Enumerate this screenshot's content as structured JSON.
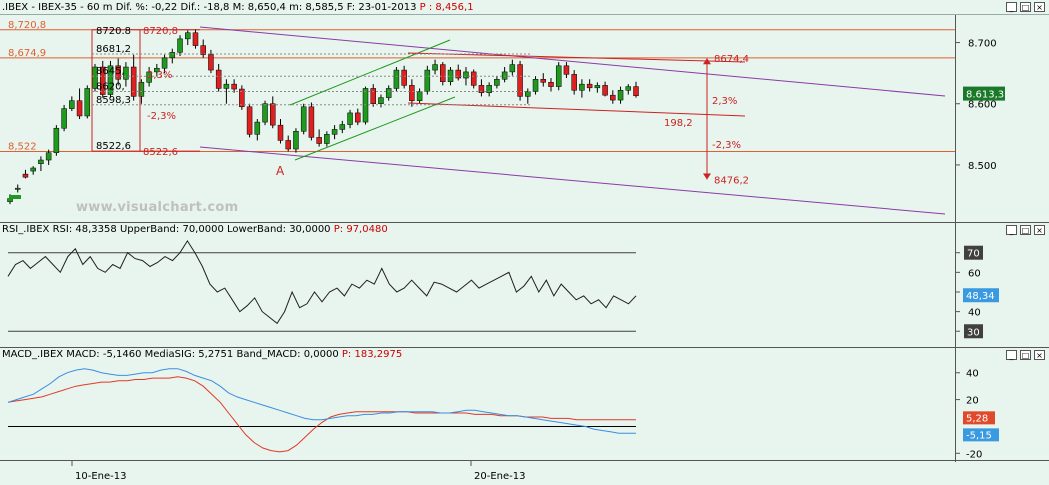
{
  "colors": {
    "background": "#e8f4ee",
    "axis_line": "#555555",
    "grid_dotted": "#8a8a8a",
    "support_resistance": "#e06030",
    "channel_purple": "#8a3aa8",
    "channel_green": "#1e9a1e",
    "range_red": "#cc2222",
    "candle_up": "#1f9a1f",
    "candle_down": "#dd2020",
    "rsi_line": "#202020",
    "macd_line": "#3a8ee0",
    "signal_line": "#e03a28",
    "last_price_box": "#1a7a2a",
    "rsi_box": "#3a9ae0",
    "macd_box": "#3a9ae0",
    "signal_box": "#e04a2a",
    "level_box": "#404040"
  },
  "headers": {
    "price": {
      "symbol": ".IBEX - IBEX-35 - 60 m",
      "dif_pct_label": "Dif. %:",
      "dif_pct": "-0,22",
      "dif_label": "Dif.:",
      "dif": "-18,8",
      "max_label": "M:",
      "max": "8,650,4",
      "min_label": "m:",
      "min": "8,585,5",
      "date_label": "F:",
      "date": "23-01-2013",
      "p_label": "P :",
      "p": "8,456,1"
    },
    "rsi": {
      "name": "RSI_.IBEX RSI:",
      "value": "48,3358",
      "upper_label": "UpperBand:",
      "upper": "70,0000",
      "lower_label": "LowerBand:",
      "lower": "30,0000",
      "p_label": "P:",
      "p": "97,0480"
    },
    "macd": {
      "name": "MACD_.IBEX MACD:",
      "value": "-5,1460",
      "signal_label": "MediaSIG:",
      "signal": "5,2751",
      "band_label": "Band_MACD:",
      "band": "0,0000",
      "p_label": "P:",
      "p": "183,2975"
    }
  },
  "window_buttons": [
    "_",
    "□",
    "×"
  ],
  "watermark": "www.visualchart.com",
  "chart_data": [
    {
      "type": "candlestick",
      "title": ".IBEX - IBEX-35 - 60 m",
      "x_ticks": [
        "10-Ene-13",
        "20-Ene-13"
      ],
      "y_ticks": [
        "8.700",
        "8.600",
        "8.500"
      ],
      "last_price": "8.613,3",
      "ylim": [
        8410,
        8745
      ],
      "bars": [
        [
          8440,
          8452,
          8436,
          8445
        ],
        [
          8460,
          8468,
          8455,
          8462
        ],
        [
          8485,
          8492,
          8478,
          8480
        ],
        [
          8490,
          8498,
          8484,
          8495
        ],
        [
          8502,
          8514,
          8490,
          8508
        ],
        [
          8508,
          8525,
          8500,
          8520
        ],
        [
          8520,
          8565,
          8515,
          8560
        ],
        [
          8560,
          8598,
          8555,
          8592
        ],
        [
          8592,
          8612,
          8588,
          8605
        ],
        [
          8605,
          8625,
          8575,
          8580
        ],
        [
          8580,
          8630,
          8576,
          8625
        ],
        [
          8625,
          8665,
          8620,
          8660
        ],
        [
          8660,
          8670,
          8610,
          8615
        ],
        [
          8615,
          8670,
          8610,
          8662
        ],
        [
          8662,
          8674,
          8630,
          8640
        ],
        [
          8640,
          8668,
          8628,
          8660
        ],
        [
          8660,
          8680,
          8605,
          8612
        ],
        [
          8612,
          8640,
          8600,
          8635
        ],
        [
          8635,
          8660,
          8628,
          8652
        ],
        [
          8652,
          8665,
          8645,
          8658
        ],
        [
          8658,
          8680,
          8650,
          8675
        ],
        [
          8675,
          8690,
          8666,
          8684
        ],
        [
          8684,
          8712,
          8678,
          8706
        ],
        [
          8706,
          8720,
          8696,
          8716
        ],
        [
          8716,
          8722,
          8690,
          8695
        ],
        [
          8695,
          8705,
          8675,
          8680
        ],
        [
          8680,
          8688,
          8650,
          8655
        ],
        [
          8655,
          8665,
          8620,
          8625
        ],
        [
          8625,
          8640,
          8600,
          8632
        ],
        [
          8632,
          8640,
          8618,
          8624
        ],
        [
          8624,
          8630,
          8590,
          8595
        ],
        [
          8595,
          8600,
          8545,
          8550
        ],
        [
          8550,
          8575,
          8540,
          8570
        ],
        [
          8570,
          8605,
          8565,
          8600
        ],
        [
          8600,
          8612,
          8560,
          8565
        ],
        [
          8565,
          8575,
          8535,
          8540
        ],
        [
          8540,
          8548,
          8522,
          8526
        ],
        [
          8526,
          8560,
          8520,
          8555
        ],
        [
          8555,
          8600,
          8550,
          8595
        ],
        [
          8595,
          8602,
          8540,
          8545
        ],
        [
          8545,
          8558,
          8530,
          8535
        ],
        [
          8535,
          8555,
          8530,
          8550
        ],
        [
          8550,
          8565,
          8542,
          8558
        ],
        [
          8558,
          8572,
          8552,
          8566
        ],
        [
          8566,
          8590,
          8560,
          8585
        ],
        [
          8585,
          8592,
          8565,
          8570
        ],
        [
          8570,
          8628,
          8566,
          8625
        ],
        [
          8625,
          8632,
          8595,
          8600
        ],
        [
          8600,
          8615,
          8594,
          8610
        ],
        [
          8610,
          8630,
          8605,
          8625
        ],
        [
          8625,
          8660,
          8620,
          8655
        ],
        [
          8655,
          8662,
          8625,
          8630
        ],
        [
          8630,
          8640,
          8595,
          8605
        ],
        [
          8605,
          8625,
          8600,
          8620
        ],
        [
          8620,
          8662,
          8615,
          8655
        ],
        [
          8655,
          8672,
          8648,
          8664
        ],
        [
          8664,
          8668,
          8630,
          8636
        ],
        [
          8636,
          8660,
          8630,
          8655
        ],
        [
          8655,
          8664,
          8638,
          8642
        ],
        [
          8642,
          8660,
          8630,
          8652
        ],
        [
          8652,
          8656,
          8625,
          8630
        ],
        [
          8630,
          8640,
          8612,
          8618
        ],
        [
          8618,
          8635,
          8612,
          8630
        ],
        [
          8630,
          8645,
          8625,
          8640
        ],
        [
          8640,
          8660,
          8635,
          8652
        ],
        [
          8652,
          8672,
          8646,
          8664
        ],
        [
          8664,
          8670,
          8605,
          8612
        ],
        [
          8612,
          8625,
          8600,
          8620
        ],
        [
          8620,
          8645,
          8615,
          8640
        ],
        [
          8640,
          8650,
          8628,
          8635
        ],
        [
          8635,
          8642,
          8620,
          8628
        ],
        [
          8628,
          8668,
          8622,
          8662
        ],
        [
          8662,
          8668,
          8642,
          8648
        ],
        [
          8648,
          8655,
          8615,
          8622
        ],
        [
          8622,
          8640,
          8610,
          8632
        ],
        [
          8632,
          8640,
          8620,
          8626
        ],
        [
          8626,
          8635,
          8618,
          8630
        ],
        [
          8630,
          8636,
          8612,
          8614
        ],
        [
          8614,
          8622,
          8600,
          8606
        ],
        [
          8606,
          8628,
          8600,
          8622
        ],
        [
          8622,
          8632,
          8615,
          8628
        ],
        [
          8628,
          8636,
          8610,
          8613
        ]
      ],
      "horizontal_levels": [
        {
          "value": 8720.8,
          "label": "8,720,8"
        },
        {
          "value": 8674.9,
          "label": "8,674,9"
        },
        {
          "value": 8522,
          "label": "8,522"
        }
      ],
      "range_box": {
        "label_high": "8720,8",
        "label_low": "8522,6",
        "fib_labels": [
          "8720.8",
          "8681,2",
          "8645,",
          "8620,",
          "8598,3",
          "8522,6"
        ],
        "pct_up": "2,3%",
        "pct_down": "-2,3%"
      },
      "projection": {
        "high_label": "8674,4",
        "low_label": "8476,2",
        "range_label": "198,2",
        "pct_up": "2,3%",
        "pct_down": "-2,3%"
      },
      "pivot_label": "A"
    },
    {
      "type": "line",
      "title": "RSI_.IBEX RSI",
      "y_ticks": [
        "70",
        "60",
        "50",
        "40",
        "30"
      ],
      "bands": [
        30,
        70
      ],
      "last_value": "48,34",
      "ylim": [
        23,
        78
      ],
      "values": [
        58,
        64,
        66,
        62,
        65,
        68,
        64,
        60,
        68,
        72,
        64,
        68,
        62,
        60,
        64,
        62,
        70,
        67,
        66,
        63,
        65,
        68,
        66,
        70,
        76,
        70,
        63,
        54,
        50,
        52,
        46,
        40,
        43,
        47,
        40,
        37,
        34,
        40,
        50,
        42,
        44,
        50,
        45,
        50,
        52,
        48,
        54,
        52,
        56,
        54,
        62,
        54,
        50,
        52,
        56,
        52,
        48,
        55,
        54,
        52,
        50,
        53,
        56,
        52,
        54,
        56,
        58,
        60,
        50,
        53,
        58,
        50,
        56,
        48,
        54,
        50,
        46,
        48,
        44,
        46,
        42,
        48,
        46,
        44,
        48
      ]
    },
    {
      "type": "line",
      "title": "MACD_.IBEX MACD",
      "y_ticks": [
        "40",
        "20",
        "-20"
      ],
      "last_macd": "-5,15",
      "last_signal": "5,28",
      "ylim": [
        -25,
        48
      ],
      "series": [
        {
          "name": "MACD",
          "values": [
            18,
            20,
            22,
            24,
            28,
            32,
            37,
            40,
            42,
            43,
            42,
            40,
            39,
            38,
            38,
            39,
            40,
            40,
            42,
            43,
            43,
            41,
            38,
            36,
            34,
            30,
            25,
            22,
            20,
            18,
            16,
            14,
            12,
            10,
            8,
            6,
            5,
            5,
            6,
            7,
            8,
            8,
            9,
            9,
            10,
            10,
            11,
            11,
            11,
            11,
            11,
            10,
            10,
            11,
            12,
            12,
            11,
            10,
            9,
            8,
            8,
            7,
            6,
            5,
            4,
            3,
            2,
            1,
            0,
            -2,
            -3,
            -4,
            -5,
            -5,
            -5
          ]
        },
        {
          "name": "MediaSIG",
          "values": [
            18,
            19,
            20,
            21,
            22,
            24,
            26,
            28,
            30,
            31,
            32,
            33,
            33,
            34,
            34,
            35,
            35,
            36,
            36,
            36,
            37,
            36,
            34,
            30,
            24,
            18,
            10,
            2,
            -6,
            -12,
            -16,
            -18,
            -19,
            -18,
            -14,
            -8,
            -2,
            3,
            7,
            9,
            10,
            11,
            11,
            11,
            11,
            11,
            11,
            11,
            10,
            10,
            10,
            10,
            10,
            10,
            10,
            9,
            9,
            9,
            8,
            8,
            8,
            7,
            7,
            7,
            6,
            6,
            6,
            5,
            5,
            5,
            5,
            5,
            5,
            5,
            5
          ]
        }
      ]
    }
  ]
}
